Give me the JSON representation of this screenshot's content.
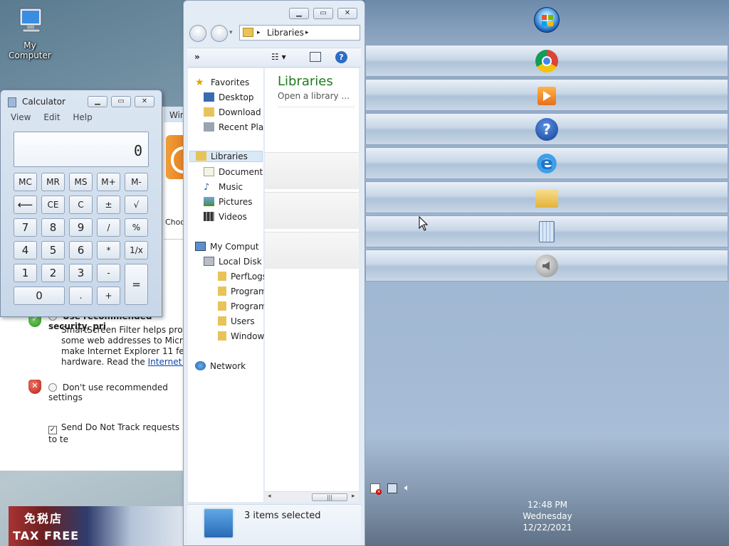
{
  "desktop": {
    "icon_label": "My Computer"
  },
  "ie_setup": {
    "window_title_fragment": "Wir",
    "choose_fragment": "Choo",
    "option1_fragment": "Use recommended security, pri",
    "smartscreen_lines": [
      "SmartScreen Filter helps protect",
      "some web addresses to Microsof",
      "make Internet Explorer 11 feature",
      "hardware. Read the"
    ],
    "smartscreen_link": "Internet Expl",
    "option2": "Don't use recommended settings",
    "dnt_label": "Send Do Not Track requests to te",
    "dnt_checked": true
  },
  "thumbnail": {
    "line1": "免税店",
    "line2": "TAX FREE"
  },
  "calculator": {
    "title": "Calculator",
    "menu": [
      "View",
      "Edit",
      "Help"
    ],
    "display": "0",
    "keys": {
      "mc": "MC",
      "mr": "MR",
      "ms": "MS",
      "mplus": "M+",
      "mminus": "M-",
      "back": "⟵",
      "ce": "CE",
      "c": "C",
      "pm": "±",
      "sqrt": "√",
      "k7": "7",
      "k8": "8",
      "k9": "9",
      "div": "/",
      "pct": "%",
      "k4": "4",
      "k5": "5",
      "k6": "6",
      "mul": "*",
      "recip": "1/x",
      "k1": "1",
      "k2": "2",
      "k3": "3",
      "sub": "-",
      "eq": "=",
      "k0": "0",
      "dot": ".",
      "add": "+"
    }
  },
  "explorer": {
    "address": "Libraries",
    "nav": {
      "favorites": "Favorites",
      "desktop": "Desktop",
      "downloads": "Download",
      "recent": "Recent Pla",
      "libraries": "Libraries",
      "documents": "Document",
      "music": "Music",
      "pictures": "Pictures",
      "videos": "Videos",
      "computer": "My Comput",
      "local_disk": "Local Disk",
      "perflogs": "PerfLogs",
      "program1": "Program",
      "program2": "Program",
      "users": "Users",
      "windows": "Window",
      "network": "Network"
    },
    "content_title": "Libraries",
    "content_subtitle": "Open a library ...",
    "status": "3 items selected"
  },
  "clock": {
    "time": "12:48 PM",
    "day": "Wednesday",
    "date": "12/22/2021"
  },
  "colors": {
    "content_title": "#1e7b1e",
    "link": "#0645ad"
  }
}
